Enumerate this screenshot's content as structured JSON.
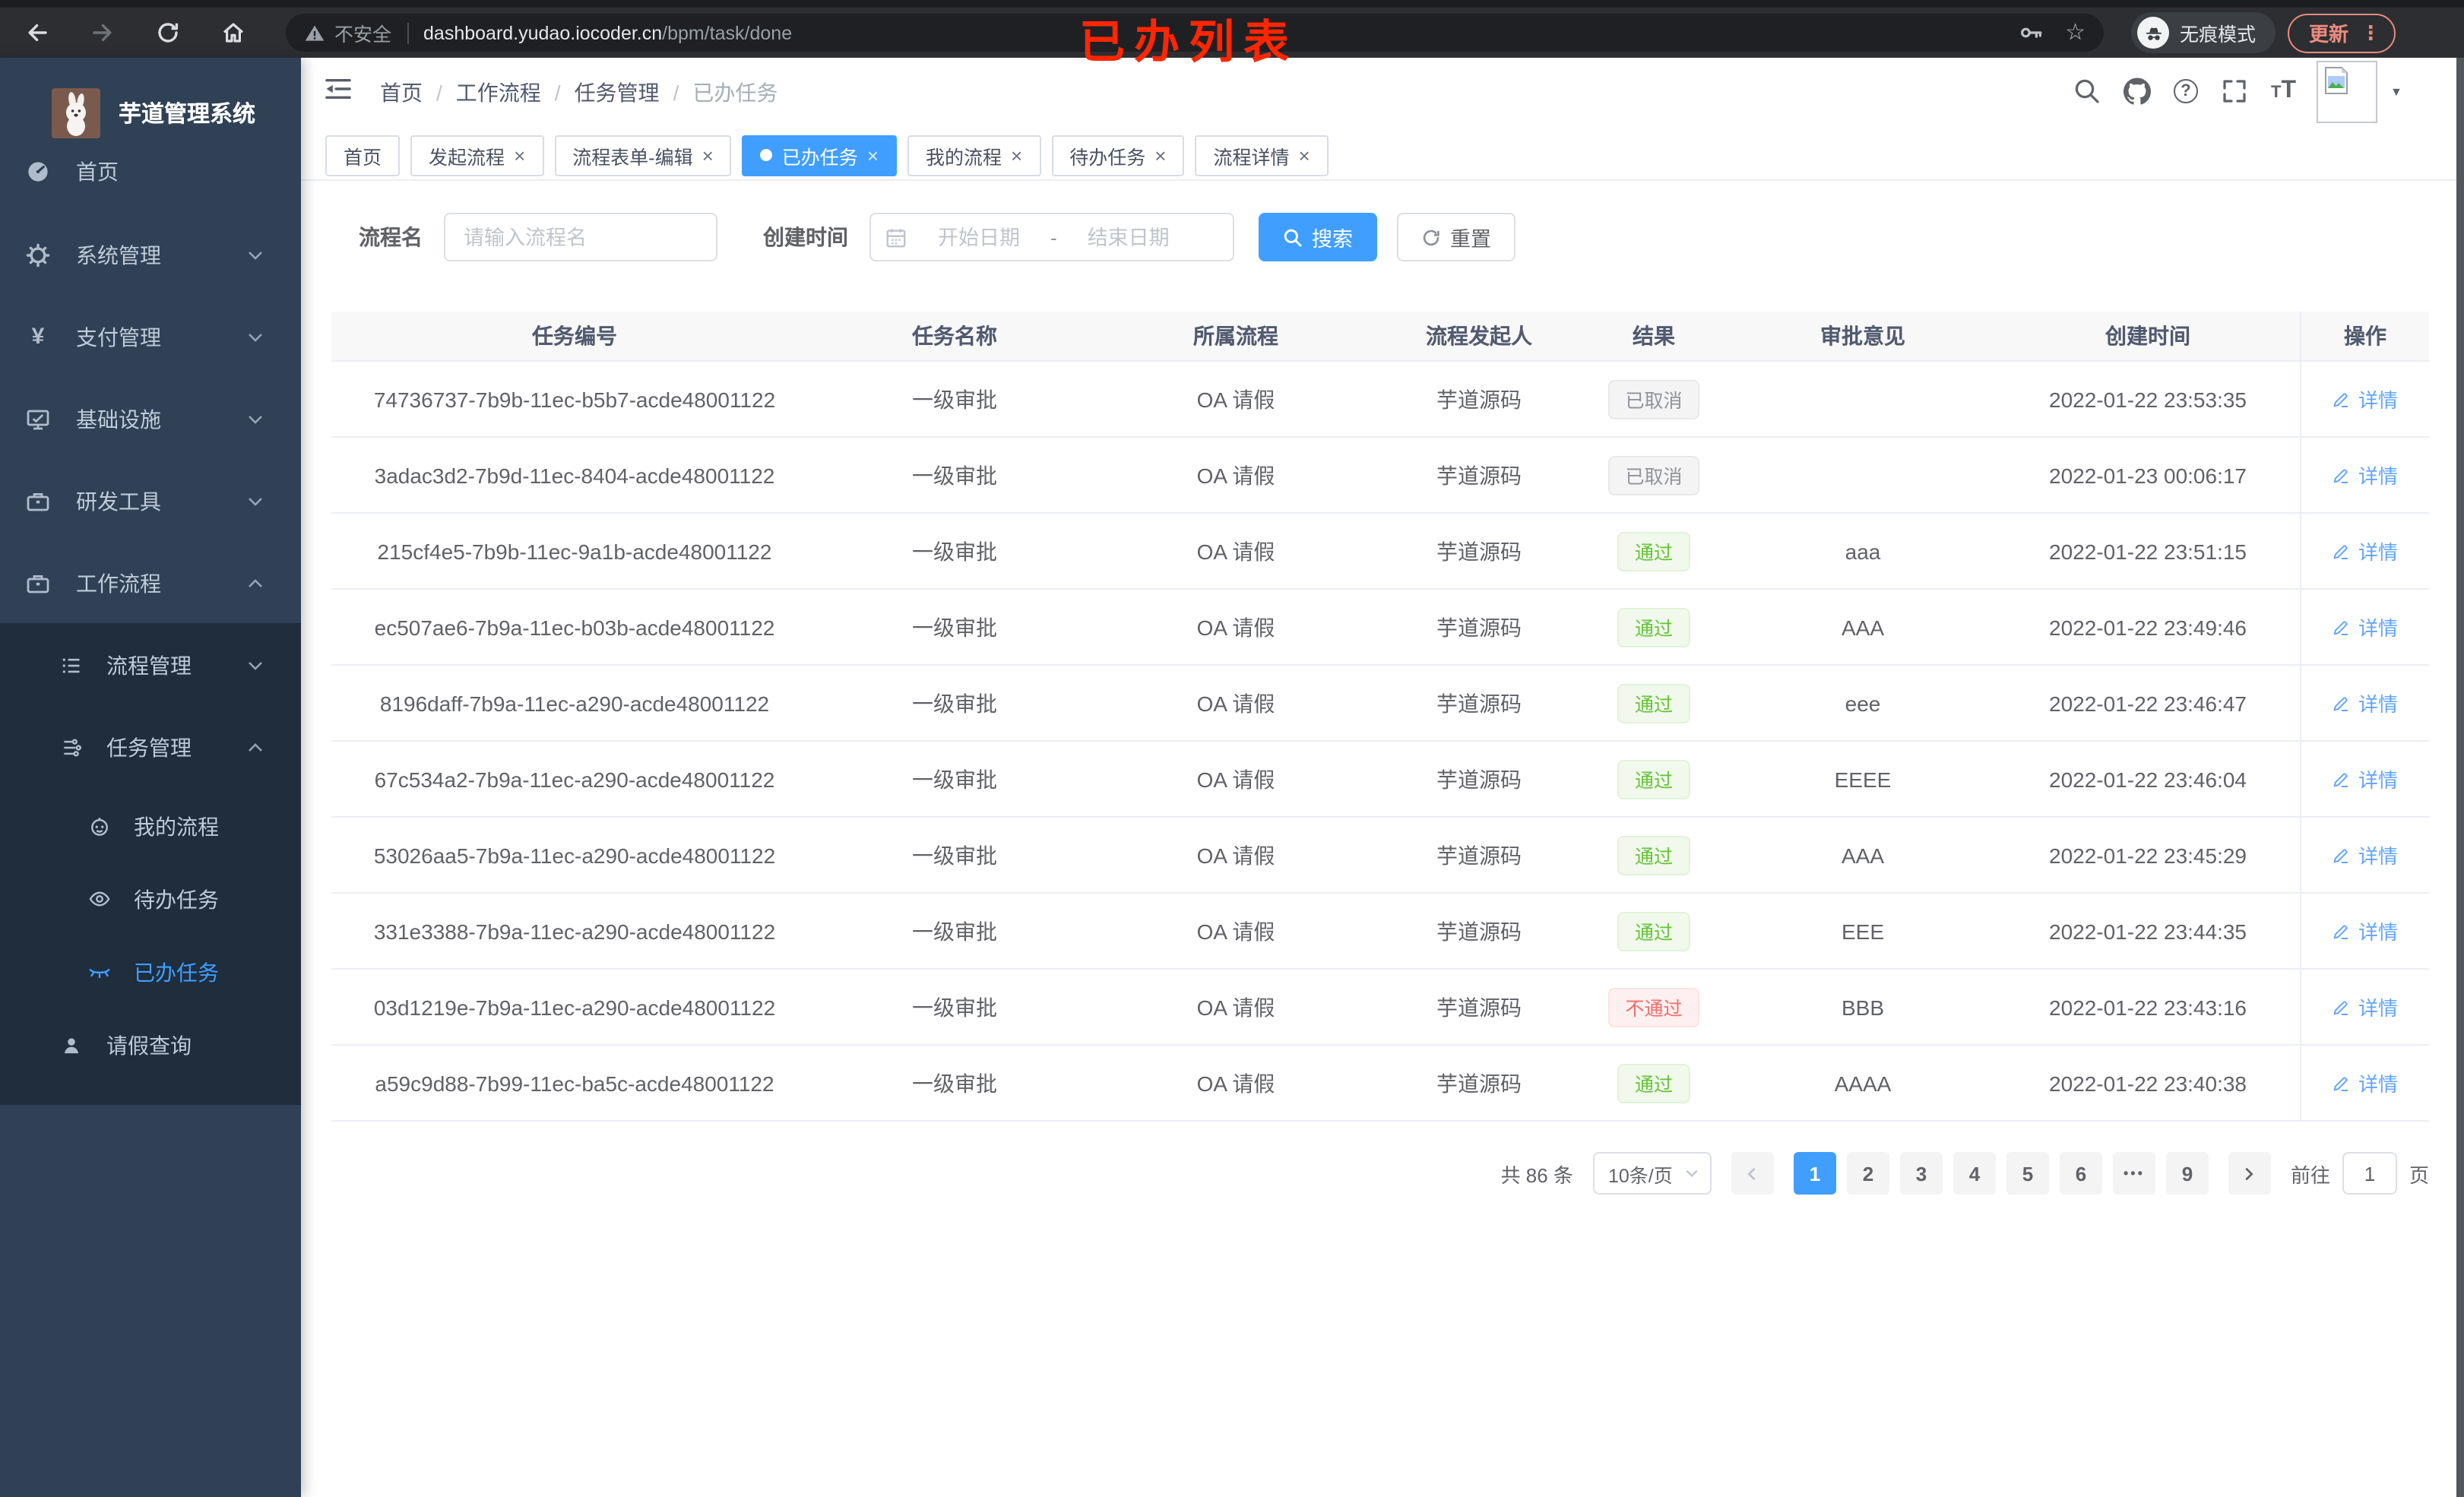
{
  "browser": {
    "security_label": "不安全",
    "url_host": "dashboard.yudao.iocoder.cn",
    "url_path": "/bpm/task/done",
    "overlay_title": "已办列表",
    "incognito_label": "无痕模式",
    "update_label": "更新"
  },
  "icons": {
    "yen": "¥",
    "star": "☆",
    "dots_vertical": "⋮",
    "caret_down": "▼",
    "question": "?",
    "text_small": "T",
    "text_large": "T",
    "range_separator": "-"
  },
  "sidebar": {
    "app_title": "芋道管理系统",
    "items": {
      "home": "首页",
      "system": "系统管理",
      "pay": "支付管理",
      "infra": "基础设施",
      "devtools": "研发工具",
      "workflow": "工作流程",
      "process_mgmt": "流程管理",
      "task_mgmt": "任务管理",
      "my_process": "我的流程",
      "todo": "待办任务",
      "done": "已办任务",
      "leave": "请假查询"
    }
  },
  "header": {
    "breadcrumb": [
      "首页",
      "工作流程",
      "任务管理",
      "已办任务"
    ],
    "separator": "/"
  },
  "tabs": [
    {
      "label": "首页",
      "cls": "tab",
      "dotcls": "tdot off",
      "xcls": "tabx off",
      "x": "×"
    },
    {
      "label": "发起流程",
      "cls": "tab",
      "dotcls": "tdot off",
      "xcls": "tabx",
      "x": "×"
    },
    {
      "label": "流程表单-编辑",
      "cls": "tab",
      "dotcls": "tdot off",
      "xcls": "tabx",
      "x": "×"
    },
    {
      "label": "已办任务",
      "cls": "tab active",
      "dotcls": "tdot",
      "xcls": "tabx",
      "x": "×"
    },
    {
      "label": "我的流程",
      "cls": "tab",
      "dotcls": "tdot off",
      "xcls": "tabx",
      "x": "×"
    },
    {
      "label": "待办任务",
      "cls": "tab",
      "dotcls": "tdot off",
      "xcls": "tabx",
      "x": "×"
    },
    {
      "label": "流程详情",
      "cls": "tab",
      "dotcls": "tdot off",
      "xcls": "tabx",
      "x": "×"
    }
  ],
  "filters": {
    "name_label": "流程名",
    "name_placeholder": "请输入流程名",
    "time_label": "创建时间",
    "start_placeholder": "开始日期",
    "end_placeholder": "结束日期",
    "search_label": "搜索",
    "reset_label": "重置"
  },
  "table": {
    "columns": [
      "任务编号",
      "任务名称",
      "所属流程",
      "流程发起人",
      "结果",
      "审批意见",
      "创建时间",
      "操作"
    ],
    "action_label": "详情",
    "rows": [
      {
        "id": "74736737-7b9b-11ec-b5b7-acde48001122",
        "name": "一级审批",
        "flow": "OA 请假",
        "starter": "芋道源码",
        "result": "已取消",
        "result_cls": "badge info",
        "comment": "",
        "created": "2022-01-22 23:53:35"
      },
      {
        "id": "3adac3d2-7b9d-11ec-8404-acde48001122",
        "name": "一级审批",
        "flow": "OA 请假",
        "starter": "芋道源码",
        "result": "已取消",
        "result_cls": "badge info",
        "comment": "",
        "created": "2022-01-23 00:06:17"
      },
      {
        "id": "215cf4e5-7b9b-11ec-9a1b-acde48001122",
        "name": "一级审批",
        "flow": "OA 请假",
        "starter": "芋道源码",
        "result": "通过",
        "result_cls": "badge success",
        "comment": "aaa",
        "created": "2022-01-22 23:51:15"
      },
      {
        "id": "ec507ae6-7b9a-11ec-b03b-acde48001122",
        "name": "一级审批",
        "flow": "OA 请假",
        "starter": "芋道源码",
        "result": "通过",
        "result_cls": "badge success",
        "comment": "AAA",
        "created": "2022-01-22 23:49:46"
      },
      {
        "id": "8196daff-7b9a-11ec-a290-acde48001122",
        "name": "一级审批",
        "flow": "OA 请假",
        "starter": "芋道源码",
        "result": "通过",
        "result_cls": "badge success",
        "comment": "eee",
        "created": "2022-01-22 23:46:47"
      },
      {
        "id": "67c534a2-7b9a-11ec-a290-acde48001122",
        "name": "一级审批",
        "flow": "OA 请假",
        "starter": "芋道源码",
        "result": "通过",
        "result_cls": "badge success",
        "comment": "EEEE",
        "created": "2022-01-22 23:46:04"
      },
      {
        "id": "53026aa5-7b9a-11ec-a290-acde48001122",
        "name": "一级审批",
        "flow": "OA 请假",
        "starter": "芋道源码",
        "result": "通过",
        "result_cls": "badge success",
        "comment": "AAA",
        "created": "2022-01-22 23:45:29"
      },
      {
        "id": "331e3388-7b9a-11ec-a290-acde48001122",
        "name": "一级审批",
        "flow": "OA 请假",
        "starter": "芋道源码",
        "result": "通过",
        "result_cls": "badge success",
        "comment": "EEE",
        "created": "2022-01-22 23:44:35"
      },
      {
        "id": "03d1219e-7b9a-11ec-a290-acde48001122",
        "name": "一级审批",
        "flow": "OA 请假",
        "starter": "芋道源码",
        "result": "不通过",
        "result_cls": "badge danger",
        "comment": "BBB",
        "created": "2022-01-22 23:43:16"
      },
      {
        "id": "a59c9d88-7b99-11ec-ba5c-acde48001122",
        "name": "一级审批",
        "flow": "OA 请假",
        "starter": "芋道源码",
        "result": "通过",
        "result_cls": "badge success",
        "comment": "AAAA",
        "created": "2022-01-22 23:40:38"
      }
    ]
  },
  "pagination": {
    "total": "共 86 条",
    "page_size": "10条/页",
    "pages": [
      {
        "t": "1",
        "cls": "page active"
      },
      {
        "t": "2",
        "cls": "page"
      },
      {
        "t": "3",
        "cls": "page"
      },
      {
        "t": "4",
        "cls": "page"
      },
      {
        "t": "5",
        "cls": "page"
      },
      {
        "t": "6",
        "cls": "page"
      },
      {
        "t": "•••",
        "cls": "page dots"
      },
      {
        "t": "9",
        "cls": "page"
      }
    ],
    "goto_label": "前往",
    "goto_value": "1",
    "goto_suffix": "页"
  },
  "colors": {
    "primary": "#409eff",
    "sidebar_bg": "#304156",
    "submenu_bg": "#1f2d3d",
    "success_text": "#67c23a",
    "danger_text": "#f56c6c",
    "info_text": "#909399",
    "overlay_red": "#ff2600",
    "update_accent": "#e98a7e"
  }
}
